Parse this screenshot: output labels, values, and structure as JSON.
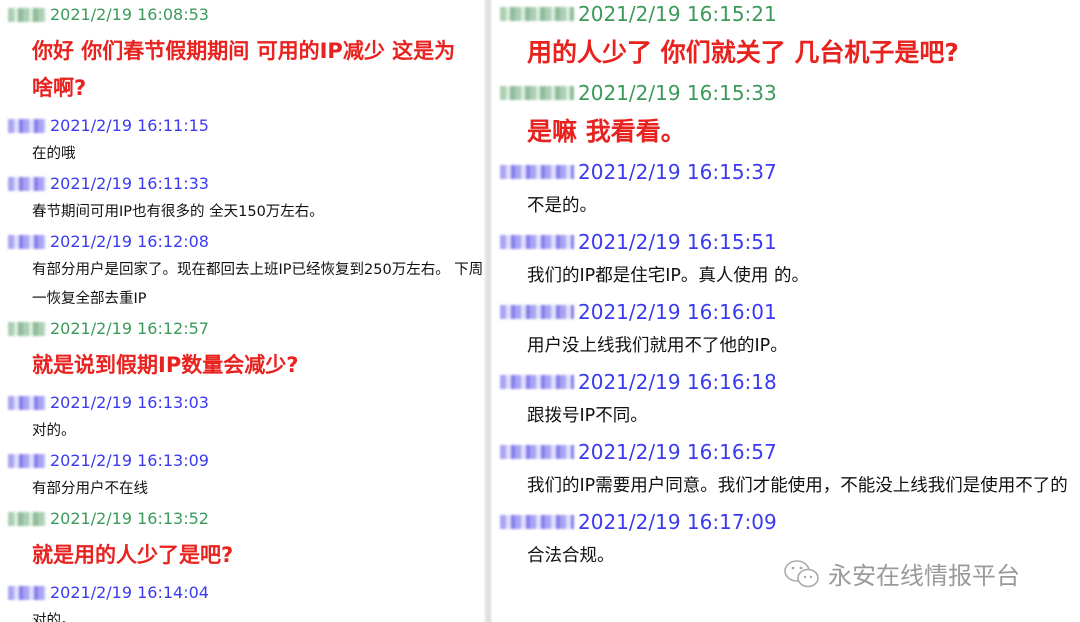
{
  "left": [
    {
      "type": "hdr",
      "color": "green",
      "time": "2021/2/19 16:08:53"
    },
    {
      "type": "red",
      "text": "你好 你们春节假期期间 可用的IP减少 这是为啥啊?"
    },
    {
      "type": "hdr",
      "color": "blue",
      "time": "2021/2/19 16:11:15"
    },
    {
      "type": "msg",
      "text": "在的哦"
    },
    {
      "type": "hdr",
      "color": "blue",
      "time": "2021/2/19 16:11:33"
    },
    {
      "type": "msg",
      "text": "春节期间可用IP也有很多的 全天150万左右。"
    },
    {
      "type": "hdr",
      "color": "blue",
      "time": "2021/2/19 16:12:08"
    },
    {
      "type": "msg",
      "text": "有部分用户是回家了。现在都回去上班IP已经恢复到250万左右。 下周一恢复全部去重IP"
    },
    {
      "type": "hdr",
      "color": "green",
      "time": "2021/2/19 16:12:57"
    },
    {
      "type": "red",
      "text": "就是说到假期IP数量会减少?"
    },
    {
      "type": "hdr",
      "color": "blue",
      "time": "2021/2/19 16:13:03"
    },
    {
      "type": "msg",
      "text": "对的。"
    },
    {
      "type": "hdr",
      "color": "blue",
      "time": "2021/2/19 16:13:09"
    },
    {
      "type": "msg",
      "text": "有部分用户不在线"
    },
    {
      "type": "hdr",
      "color": "green",
      "time": "2021/2/19 16:13:52"
    },
    {
      "type": "red",
      "text": "就是用的人少了是吧?"
    },
    {
      "type": "hdr",
      "color": "blue",
      "time": "2021/2/19 16:14:04"
    },
    {
      "type": "msg",
      "text": "对的。"
    }
  ],
  "right": [
    {
      "type": "hdr",
      "color": "green",
      "time": "2021/2/19 16:15:21"
    },
    {
      "type": "red",
      "text": "用的人少了 你们就关了 几台机子是吧?"
    },
    {
      "type": "hdr",
      "color": "green",
      "time": "2021/2/19 16:15:33"
    },
    {
      "type": "red",
      "text": "是嘛 我看看。"
    },
    {
      "type": "hdr",
      "color": "blue",
      "time": "2021/2/19 16:15:37"
    },
    {
      "type": "msg",
      "text": "不是的。"
    },
    {
      "type": "hdr",
      "color": "blue",
      "time": "2021/2/19 16:15:51"
    },
    {
      "type": "msg",
      "text": "我们的IP都是住宅IP。真人使用 的。"
    },
    {
      "type": "hdr",
      "color": "blue",
      "time": "2021/2/19 16:16:01"
    },
    {
      "type": "msg",
      "text": "用户没上线我们就用不了他的IP。"
    },
    {
      "type": "hdr",
      "color": "blue",
      "time": "2021/2/19 16:16:18"
    },
    {
      "type": "msg",
      "text": "跟拨号IP不同。"
    },
    {
      "type": "hdr",
      "color": "blue",
      "time": "2021/2/19 16:16:57"
    },
    {
      "type": "msg",
      "text": "我们的IP需要用户同意。我们才能使用，不能没上线我们是使用不了的"
    },
    {
      "type": "hdr",
      "color": "blue",
      "time": "2021/2/19 16:17:09"
    },
    {
      "type": "msg",
      "text": "合法合规。"
    }
  ],
  "watermark": {
    "icon": "wechat-icon",
    "text": "永安在线情报平台"
  },
  "colors": {
    "question": "#e8221e",
    "customer_time": "#3a9a5a",
    "agent_time": "#3a3af0"
  }
}
